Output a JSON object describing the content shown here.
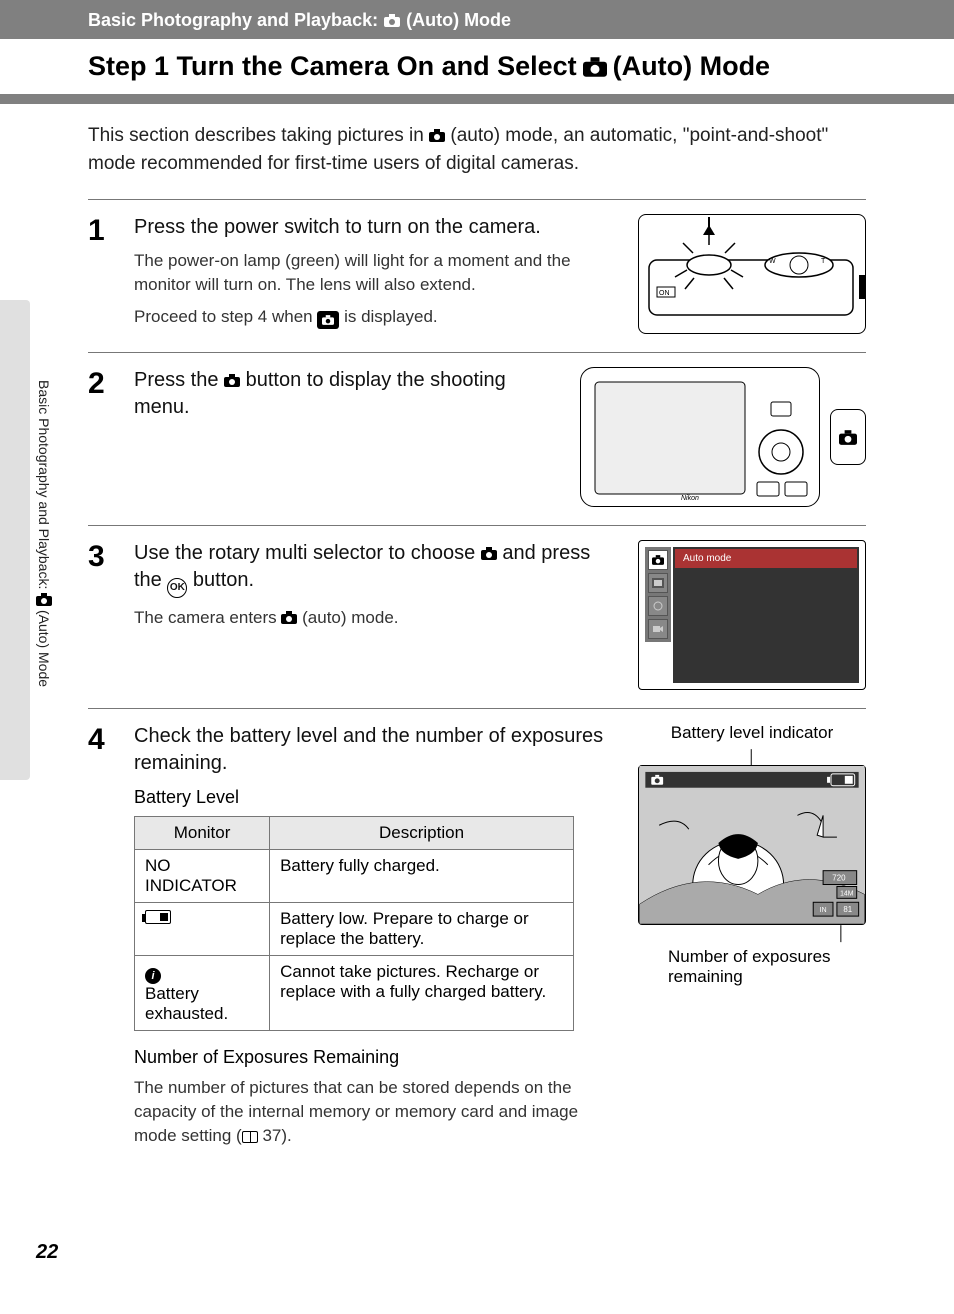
{
  "header": {
    "breadcrumb_prefix": "Basic Photography and Playback:",
    "breadcrumb_suffix": "(Auto) Mode",
    "title_prefix": "Step 1 Turn the Camera On and Select",
    "title_suffix": "(Auto) Mode"
  },
  "intro": {
    "line1_a": "This section describes taking pictures in ",
    "line1_b": " (auto) mode, an automatic, \"point-and-shoot\" mode recommended for first-time users of digital cameras."
  },
  "side_tab": {
    "text_a": "Basic Photography and Playback: ",
    "text_b": " (Auto) Mode"
  },
  "steps": {
    "s1": {
      "num": "1",
      "heading": "Press the power switch to turn on the camera.",
      "desc1": "The power-on lamp (green) will light for a moment and the monitor will turn on. The lens will also extend.",
      "desc2_a": "Proceed to step 4 when ",
      "desc2_b": " is displayed."
    },
    "s2": {
      "num": "2",
      "heading_a": "Press the ",
      "heading_b": " button to display the shooting menu."
    },
    "s3": {
      "num": "3",
      "heading_a": "Use the rotary multi selector to choose ",
      "heading_b": " and press the ",
      "heading_c": " button.",
      "desc_a": "The camera enters ",
      "desc_b": " (auto) mode.",
      "menu_label": "Auto mode"
    },
    "s4": {
      "num": "4",
      "heading": "Check the battery level and the number of exposures remaining.",
      "bat_heading": "Battery Level",
      "table": {
        "col1": "Monitor",
        "col2": "Description",
        "r1c1": "NO INDICATOR",
        "r1c2": "Battery fully charged.",
        "r2c2": "Battery low. Prepare to charge or replace the battery.",
        "r3c1": "Battery exhausted.",
        "r3c2": "Cannot take pictures. Recharge or replace with a fully charged battery."
      },
      "exp_heading": "Number of Exposures Remaining",
      "exp_body_a": "The number of pictures that can be stored depends on the capacity of the internal memory or memory card and image mode setting (",
      "exp_body_b": " 37).",
      "side_top": "Battery level indicator",
      "side_bot": "Number of exposures remaining"
    }
  },
  "page_number": "22"
}
